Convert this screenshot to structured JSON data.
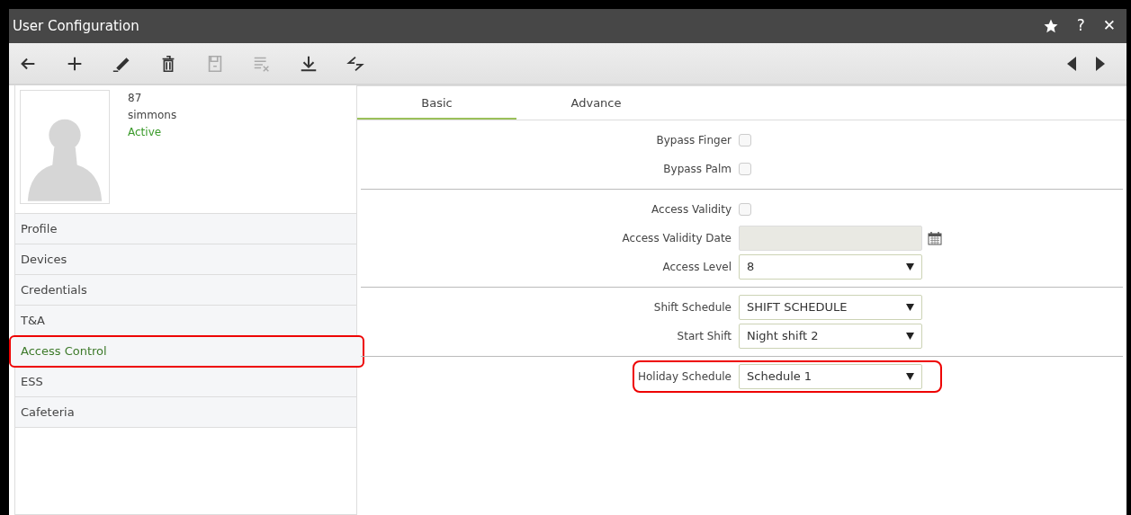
{
  "window": {
    "title": "User Configuration",
    "actions": [
      {
        "kind": "star"
      },
      {
        "kind": "help",
        "label": "?"
      },
      {
        "kind": "close",
        "label": "✕"
      }
    ]
  },
  "toolbar": {
    "tools": [
      {
        "kind": "back",
        "disabled": false
      },
      {
        "kind": "add",
        "disabled": false
      },
      {
        "kind": "edit",
        "disabled": false
      },
      {
        "kind": "delete",
        "disabled": false
      },
      {
        "kind": "save",
        "disabled": true
      },
      {
        "kind": "clear",
        "disabled": true
      },
      {
        "kind": "download",
        "disabled": false
      },
      {
        "kind": "swap",
        "disabled": false
      }
    ],
    "nav": [
      {
        "kind": "prev"
      },
      {
        "kind": "next"
      }
    ]
  },
  "user": {
    "id": "87",
    "name": "simmons",
    "status": "Active"
  },
  "sidebar": {
    "items": [
      {
        "label": "Profile",
        "selected": false,
        "highlighted": false
      },
      {
        "label": "Devices",
        "selected": false,
        "highlighted": false
      },
      {
        "label": "Credentials",
        "selected": false,
        "highlighted": false
      },
      {
        "label": "T&A",
        "selected": false,
        "highlighted": false
      },
      {
        "label": "Access Control",
        "selected": true,
        "highlighted": true
      },
      {
        "label": "ESS",
        "selected": false,
        "highlighted": false
      },
      {
        "label": "Cafeteria",
        "selected": false,
        "highlighted": false
      }
    ]
  },
  "tabs": [
    {
      "label": "Basic",
      "selected": true
    },
    {
      "label": "Advance",
      "selected": false
    }
  ],
  "form": {
    "sections": [
      {
        "fields": [
          {
            "label": "Bypass Finger",
            "kind": "checkbox",
            "checked": false,
            "highlighted": false
          },
          {
            "label": "Bypass Palm",
            "kind": "checkbox",
            "checked": false,
            "highlighted": false
          }
        ]
      },
      {
        "fields": [
          {
            "label": "Access Validity",
            "kind": "checkbox",
            "checked": false,
            "highlighted": false
          },
          {
            "label": "Access Validity Date",
            "kind": "date",
            "disabled": true,
            "highlighted": false
          },
          {
            "label": "Access Level",
            "kind": "select",
            "value": "8",
            "highlighted": false
          }
        ]
      },
      {
        "fields": [
          {
            "label": "Shift Schedule",
            "kind": "select",
            "value": "SHIFT SCHEDULE",
            "highlighted": false
          },
          {
            "label": "Start Shift",
            "kind": "select",
            "value": "Night shift 2",
            "highlighted": false
          }
        ]
      },
      {
        "fields": [
          {
            "label": "Holiday Schedule",
            "kind": "select",
            "value": "Schedule 1",
            "highlighted": true
          }
        ]
      }
    ]
  }
}
